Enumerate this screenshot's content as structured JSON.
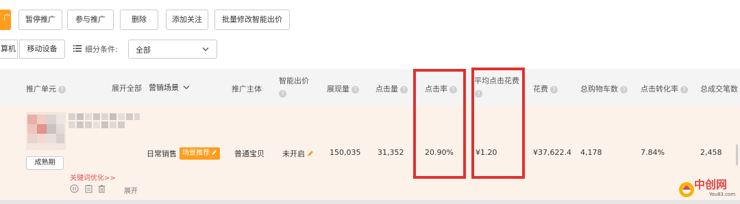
{
  "toolbar": {
    "orange_tab_label": "广",
    "buttons": [
      "暂停推广",
      "参与推广",
      "删除",
      "添加关注",
      "批量修改智能出价"
    ]
  },
  "device": {
    "pc_label": "算机",
    "mobile_label": "移动设备"
  },
  "filter": {
    "label": "细分条件:",
    "value": "全部"
  },
  "table": {
    "headers": {
      "unit": "推广单元",
      "expand_all": "展开全部",
      "scene": "营销场景",
      "subject": "推广主体",
      "smart_bid_line1": "智能出价",
      "impressions": "展现量",
      "clicks": "点击量",
      "ctr": "点击率",
      "avg_cpc": "平均点击花费",
      "cost": "花费",
      "cart": "总购物车数",
      "cvr": "点击转化率",
      "orders": "总成交笔数"
    },
    "row": {
      "stage_label": "成熟期",
      "keyword_link": "关键词优化>>",
      "expand_label": "展开",
      "scene": "日常销售",
      "scene_badge": "场景推荐",
      "subject": "普通宝贝",
      "smart_bid": "未开启",
      "impressions": "150,035",
      "clicks": "31,352",
      "ctr": "20.90%",
      "avg_cpc": "¥1.20",
      "cost": "¥37,622.4",
      "cart": "4,178",
      "cvr": "7.84%",
      "orders": "2,458"
    }
  },
  "watermark": {
    "title": "中创网",
    "sub": "You83.com"
  },
  "colors": {
    "accent_orange": "#ff9d1f",
    "highlight_red": "#e03030",
    "row_bg": "#fdf2ea",
    "header_bg": "#f4f4f4"
  }
}
